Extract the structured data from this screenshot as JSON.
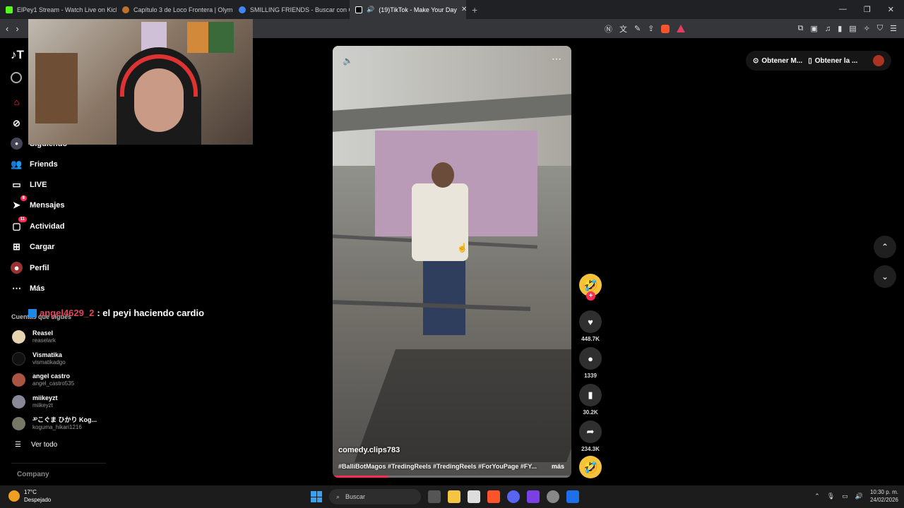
{
  "tabs": [
    {
      "title": "ElPey1 Stream - Watch Live on Kick",
      "color": "#53fc18"
    },
    {
      "title": "Capítulo 3 de Loco Frontera | Olymp...",
      "color": "#c0702a"
    },
    {
      "title": "SMILLING FRIENDS - Buscar con Goo...",
      "color": "#4285f4"
    },
    {
      "title": "(19)TikTok - Make Your Day",
      "color": "#ffffff"
    }
  ],
  "sidebar": {
    "following_label": "Siguiendo",
    "items": [
      {
        "label": "Friends",
        "icon": "friends-icon"
      },
      {
        "label": "LIVE",
        "icon": "live-icon"
      },
      {
        "label": "Mensajes",
        "icon": "messages-icon",
        "badge": "8"
      },
      {
        "label": "Actividad",
        "icon": "activity-icon",
        "badge": "11"
      },
      {
        "label": "Cargar",
        "icon": "upload-icon"
      },
      {
        "label": "Perfil",
        "icon": "profile-icon"
      },
      {
        "label": "Más",
        "icon": "more-icon"
      }
    ],
    "following_header": "Cuentas que sigues",
    "accounts": [
      {
        "name": "Reasel",
        "handle": "reaselark"
      },
      {
        "name": "Vismatika",
        "handle": "vismatikadgo"
      },
      {
        "name": "angel castro",
        "handle": "angel_castro535"
      },
      {
        "name": "miikeyzt",
        "handle": "miikeyzt"
      },
      {
        "name": "ᴶᴾこぐま ひかり Kog...",
        "handle": "koguma_hikari1216"
      }
    ],
    "see_all": "Ver todo",
    "company": "Company"
  },
  "chat": {
    "user": "angel4629_2",
    "message": ": el peyi haciendo cardio"
  },
  "video": {
    "author": "comedy.clips783",
    "tags": "#BalliBotMagos #TredingReels #TredingReels #ForYouPage #FY...",
    "more": "más",
    "progress": 0.23
  },
  "actions": {
    "likes": "448.7K",
    "comments": "1339",
    "saves": "30.2K",
    "shares": "234.3K"
  },
  "topright": {
    "btn1": "Obtener M...",
    "btn2": "Obtener la ..."
  },
  "taskbar": {
    "temp": "17°C",
    "weather": "Despejado",
    "search": "Buscar",
    "time": "10:30 p. m.",
    "date": "24/02/2026"
  }
}
